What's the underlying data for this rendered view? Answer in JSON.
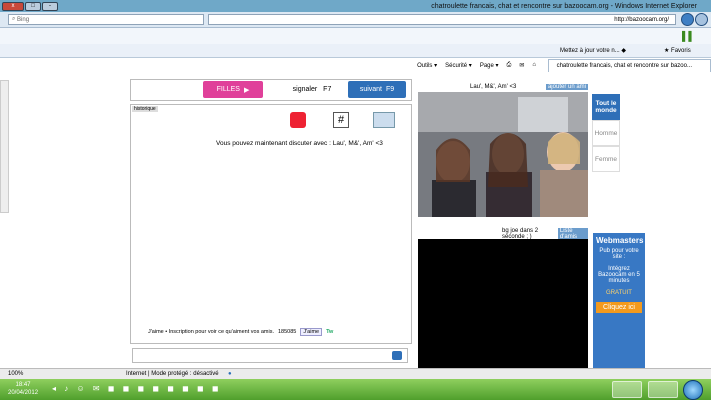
{
  "window": {
    "title": "chatroulette francais, chat et rencontre sur bazoocam.org - Windows Internet Explorer",
    "min_label": "-",
    "max_label": "□",
    "close_label": "x"
  },
  "addressbar": {
    "search_placeholder": "Bing",
    "url": "http://bazoocam.org/"
  },
  "favbar": {
    "favoris_label": "Favoris",
    "mettez_label": "Mettez à jour votre n..."
  },
  "tab": {
    "label": "chatroulette francais, chat et rencontre sur bazoo..."
  },
  "cmdbar": {
    "page_label": "Page",
    "securite_label": "Sécurité",
    "outils_label": "Outils"
  },
  "chat": {
    "suivant_label": "suivant",
    "suivant_key": "F9",
    "signaler_label": "signaler",
    "signaler_key": "F7",
    "filles_label": "FILLES",
    "historique_label": "historique",
    "message": "Vous pouvez maintenant discuter avec : Lau', M&', Am' <3",
    "jaime_label": "J'aime",
    "jaime_count": "185085",
    "inscription_text": "J'aime  •  Inscription pour voir ce qu'aiment vos amis.",
    "tw_label": "Tw"
  },
  "webcam": {
    "partner_name": "Lau', M&', Am' <3",
    "partner_action": "ajouter un ami",
    "self_status": "bg joe dans 2 seconde ; )",
    "self_action": "Liste d'amis"
  },
  "sidebar": {
    "tout_label": "Tout le monde",
    "homme_label": "Homme",
    "femme_label": "Femme"
  },
  "ad": {
    "title": "Webmasters",
    "line1": "Pub pour votre site :",
    "line2": "Intégrez Bazoocam en 5 minutes",
    "gratuit": "GRATUIT",
    "cta": "Cliquez ici"
  },
  "statusbar": {
    "zone": "Internet | Mode protégé : désactivé",
    "zoom": "100%"
  },
  "taskbar": {
    "time": "18:47",
    "date": "20/04/2012"
  }
}
